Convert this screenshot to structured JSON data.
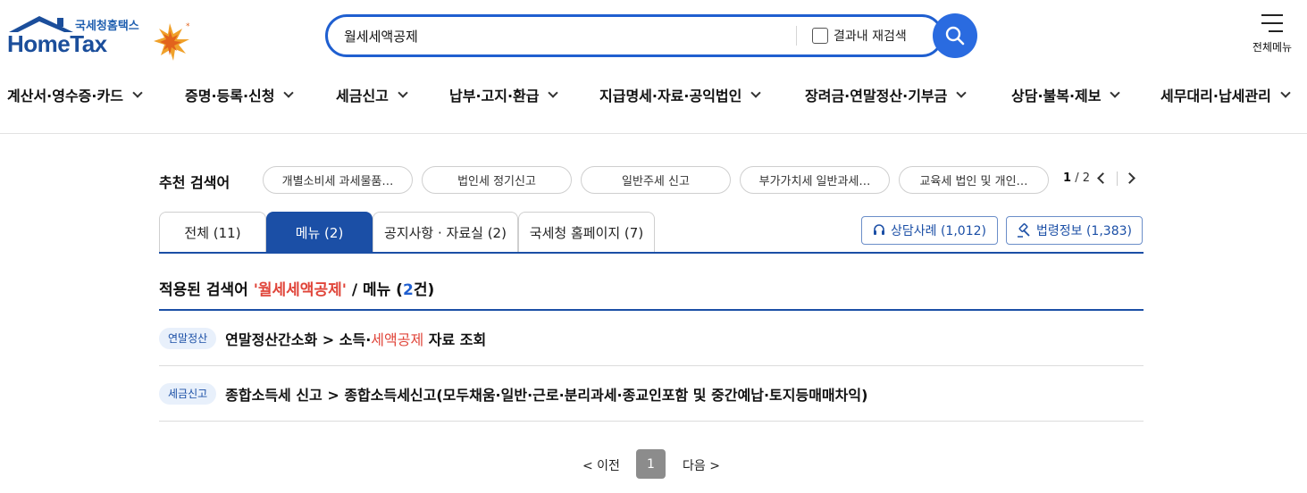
{
  "header": {
    "logo_sub": "국세청홈택스",
    "logo_main": "HomeTax",
    "search_value": "월세세액공제",
    "research_label": "결과내 재검색",
    "allmenu_label": "전체메뉴"
  },
  "gnb": [
    {
      "label": "계산서·영수증·카드"
    },
    {
      "label": "증명·등록·신청"
    },
    {
      "label": "세금신고"
    },
    {
      "label": "납부·고지·환급"
    },
    {
      "label": "지급명세·자료·공익법인"
    },
    {
      "label": "장려금·연말정산·기부금"
    },
    {
      "label": "상담·불복·제보"
    },
    {
      "label": "세무대리·납세관리"
    }
  ],
  "recommend": {
    "label": "추천 검색어",
    "chips": [
      "개별소비세 과세물품…",
      "법인세 정기신고",
      "일반주세 신고",
      "부가가치세 일반과세…",
      "교육세 법인 및 개인…"
    ],
    "page_current": "1",
    "page_total": "/ 2"
  },
  "tabs": [
    {
      "label": "전체 (11)"
    },
    {
      "label": "메뉴 (2)"
    },
    {
      "label": "공지사항 · 자료실 (2)"
    },
    {
      "label": "국세청 홈페이지 (7)"
    }
  ],
  "side_buttons": {
    "consult": "상담사례 (1,012)",
    "law": "법령정보 (1,383)"
  },
  "applied": {
    "prefix": "적용된 검색어",
    "keyword": "'월세세액공제'",
    "mid": "/ 메뉴 (",
    "count": "2",
    "suffix": "건)"
  },
  "results": [
    {
      "badge": "연말정산",
      "before": "연말정산간소화 > 소득·",
      "highlight": "세액공제",
      "after": " 자료 조회"
    },
    {
      "badge": "세금신고",
      "before": "종합소득세 신고 > 종합소득세신고(모두채움·일반·근로·분리과세·종교인포함 및 중간예납·토지등매매차익)",
      "highlight": "",
      "after": ""
    }
  ],
  "pager": {
    "prev": "< 이전",
    "current": "1",
    "next": "다음 >"
  },
  "colors": {
    "primary": "#1b4fa6",
    "search_blue": "#2a6be0",
    "highlight_red": "#e0453a"
  }
}
